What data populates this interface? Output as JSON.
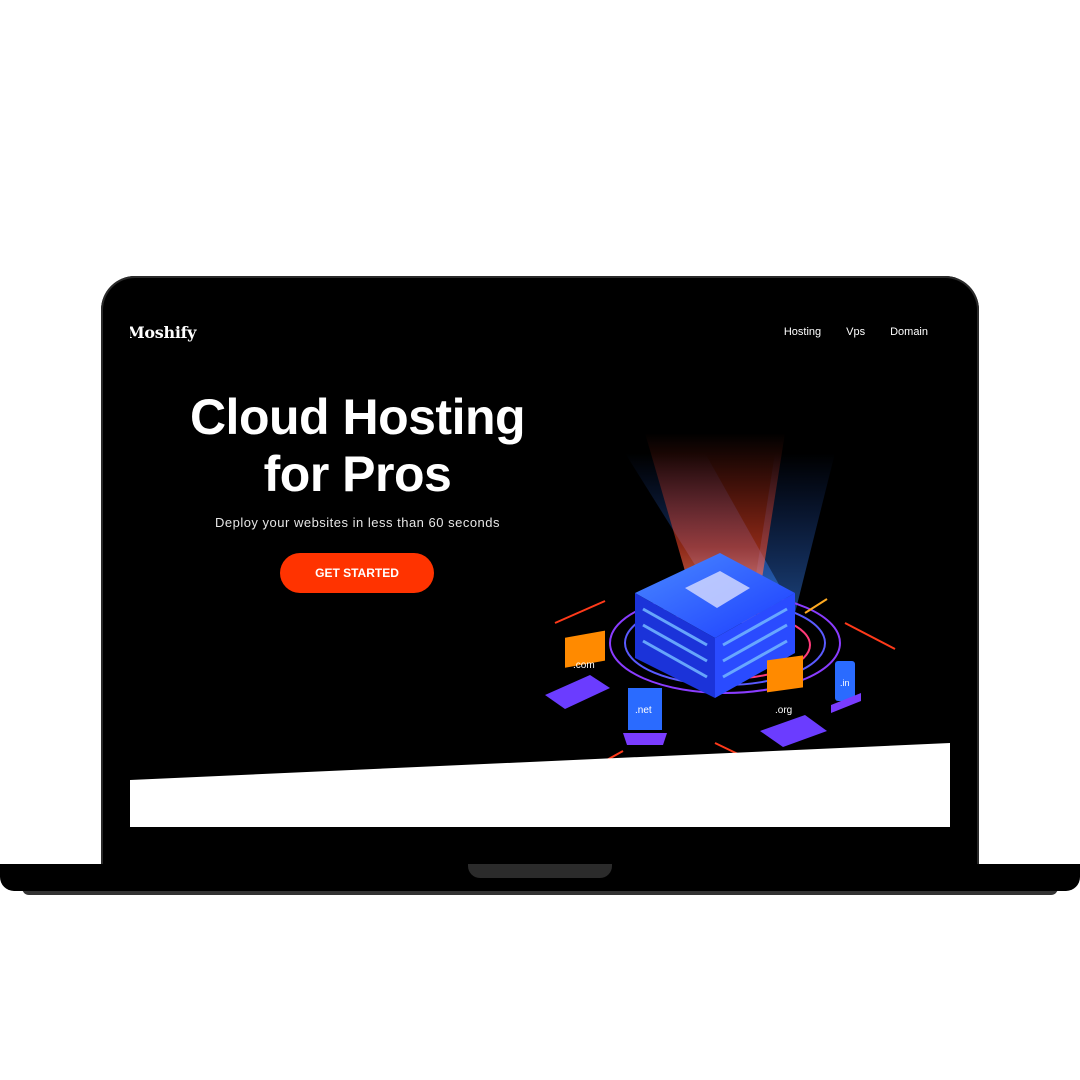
{
  "brand": {
    "logo_text": "Moshify"
  },
  "nav": {
    "items": [
      {
        "label": "Hosting"
      },
      {
        "label": "Vps"
      },
      {
        "label": "Domain"
      }
    ]
  },
  "hero": {
    "title_line1": "Cloud Hosting",
    "title_line2": "for Pros",
    "subtitle": "Deploy your websites in less than 60 seconds",
    "cta_label": "GET STARTED"
  },
  "illustration": {
    "tlds": [
      ".com",
      ".net",
      ".org",
      ".in"
    ]
  },
  "colors": {
    "accent": "#ff3300",
    "background": "#000000",
    "server_blue": "#1e3cff",
    "device_purple": "#7a3cff",
    "device_orange": "#ff8a00"
  }
}
